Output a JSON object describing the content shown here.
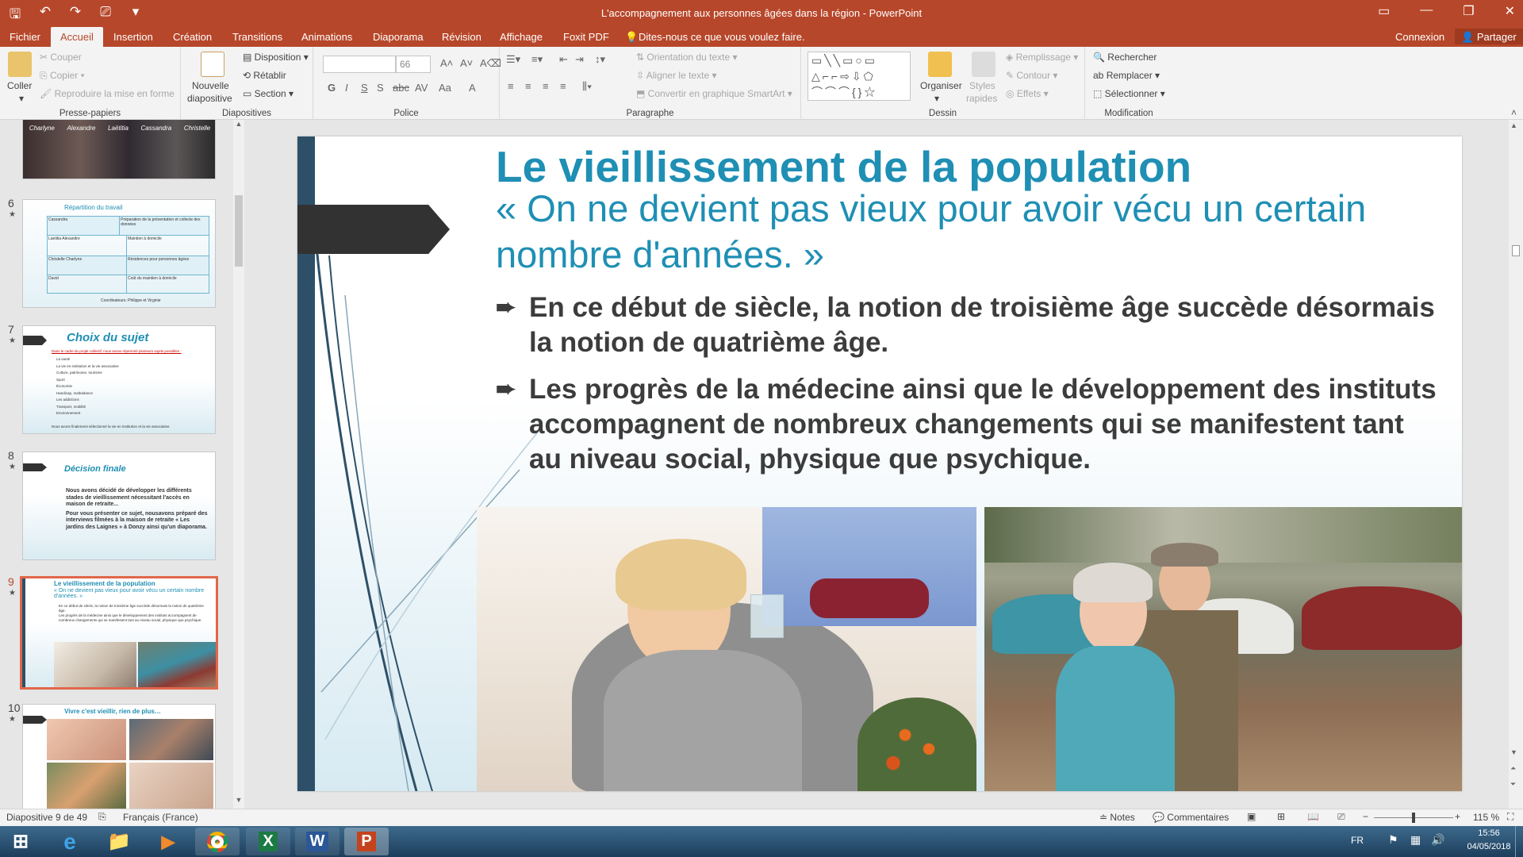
{
  "window": {
    "title": "L'accompagnement aux personnes âgées dans la région - PowerPoint",
    "qat": [
      "save-icon",
      "undo-icon",
      "redo-icon",
      "present-icon",
      "customize-icon"
    ],
    "restore_glyph": "▭",
    "minimize_glyph": "—",
    "maximize_glyph": "❐",
    "close_glyph": "✕"
  },
  "tabs": [
    "Fichier",
    "Accueil",
    "Insertion",
    "Création",
    "Transitions",
    "Animations",
    "Diaporama",
    "Révision",
    "Affichage",
    "Foxit PDF"
  ],
  "active_tab": "Accueil",
  "tell_me": "Dites-nous ce que vous voulez faire.",
  "account": {
    "signin": "Connexion",
    "share": "Partager"
  },
  "ribbon": {
    "clipboard": {
      "label": "Presse-papiers",
      "paste": "Coller",
      "cut": "Couper",
      "copy": "Copier",
      "format_painter": "Reproduire la mise en forme"
    },
    "slides": {
      "label": "Diapositives",
      "new_slide_1": "Nouvelle",
      "new_slide_2": "diapositive",
      "layout": "Disposition",
      "reset": "Rétablir",
      "section": "Section"
    },
    "font": {
      "label": "Police",
      "size": "66",
      "bold": "G",
      "italic": "I",
      "underline": "S",
      "shadow": "S",
      "strike": "abc",
      "spacing": "AV",
      "case": "Aa",
      "color": "A"
    },
    "paragraph": {
      "label": "Paragraphe",
      "text_direction": "Orientation du texte",
      "align_text": "Aligner le texte",
      "smartart": "Convertir en graphique SmartArt"
    },
    "drawing": {
      "label": "Dessin",
      "arrange": "Organiser",
      "quick_styles_1": "Styles",
      "quick_styles_2": "rapides",
      "fill": "Remplissage",
      "outline": "Contour",
      "effects": "Effets"
    },
    "editing": {
      "label": "Modification",
      "find": "Rechercher",
      "replace": "Remplacer",
      "select": "Sélectionner"
    }
  },
  "thumbnails": [
    {
      "num": "6",
      "title": "Répartition du travail",
      "footer": "Coordinateurs: Philippe et Virginie",
      "rows": [
        [
          "Cassandra",
          "Préparation de la présentation et collecte des données"
        ],
        [
          "Laetitia Alexandre",
          "Maintien à domicile"
        ],
        [
          "Christelle Charlyne",
          "Résidences pour personnes âgées"
        ],
        [
          "David",
          "Coût du maintien à domicile"
        ]
      ]
    },
    {
      "num": "7",
      "title": "Choix du sujet",
      "intro": "Dans le cadre du projet collectif, nous avons répertorié plusieurs sujets possibles :",
      "items": [
        "La santé",
        "La vie en institution et la vie associative",
        "Culture, patrimoine, tourisme",
        "Sport",
        "Économie",
        "Handicap, maltraitance",
        "Les addictions",
        "Transport, mobilité",
        "Environnement"
      ],
      "footer": "Nous avons finalement sélectionné la vie en institution et la vie associative."
    },
    {
      "num": "8",
      "title": "Décision finale",
      "bullets": [
        "Nous avons décidé de développer les différents stades de vieillissement nécessitant l'accès en maison de retraite...",
        "Pour vous présenter ce sujet, nousavons préparé des interviews filmées à la maison de retraite « Les jardins des Laignes » à Donzy ainsi qu'un diaporama."
      ]
    },
    {
      "num": "9",
      "title": "Le vieillissement de la population"
    },
    {
      "num": "10",
      "title": "Vivre c'est vieillir, rien de plus…"
    }
  ],
  "thumb_photo_names": [
    "Charlyne",
    "Alexandre",
    "Laëtitia",
    "Cassandra",
    "Christelle"
  ],
  "slide": {
    "title": "Le vieillissement de la population",
    "subtitle": "« On ne devient pas vieux pour avoir vécu un certain nombre d'années. »",
    "bullets": [
      "En ce début de siècle, la notion de troisième âge succède désormais la notion de quatrième âge.",
      "Les progrès de la médecine ainsi que le développement des instituts  accompagnent de nombreux changements qui se manifestent tant au niveau social, physique que psychique."
    ],
    "bullet_marker": "➨"
  },
  "status": {
    "slide_info": "Diapositive 9 de 49",
    "language": "Français (France)",
    "notes": "Notes",
    "comments": "Commentaires",
    "zoom": "115 %"
  },
  "taskbar": {
    "lang": "FR",
    "time": "15:56",
    "date": "04/05/2018"
  }
}
